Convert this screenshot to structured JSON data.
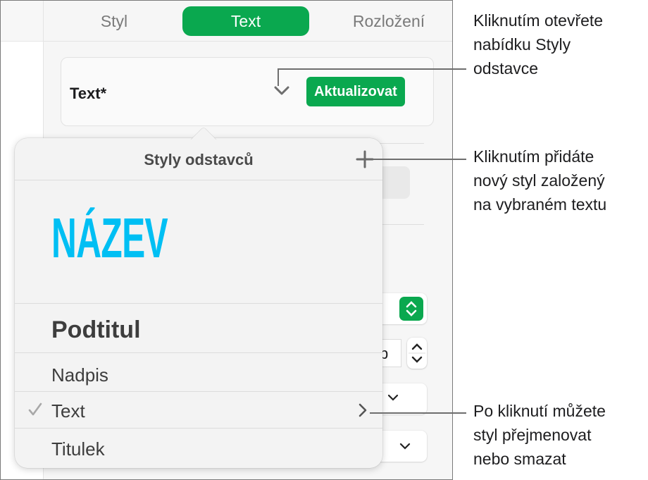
{
  "inspector": {
    "tabs": [
      {
        "label": "Styl",
        "active": false
      },
      {
        "label": "Text",
        "active": true
      },
      {
        "label": "Rozložení",
        "active": false
      }
    ],
    "paragraph_style": {
      "current": "Text*",
      "update_button": "Aktualizovat"
    },
    "partial_controls": {
      "number_field_fragment": "b"
    }
  },
  "popover": {
    "title": "Styly odstavců",
    "add_icon": "plus-icon",
    "styles": [
      {
        "label": "NÁZEV",
        "selected": false,
        "color": "#00bff3"
      },
      {
        "label": "Podtitul",
        "selected": false
      },
      {
        "label": "Nadpis",
        "selected": false
      },
      {
        "label": "Text",
        "selected": true
      },
      {
        "label": "Titulek",
        "selected": false
      }
    ]
  },
  "callouts": [
    {
      "text": "Kliknutím otevřete\nnabídku Styly\nodstavce"
    },
    {
      "text": "Kliknutím přidáte\nnový styl založený\nna vybraném textu"
    },
    {
      "text": "Po kliknutí můžete\nstyl přejmenovat\nnebo smazat"
    }
  ],
  "colors": {
    "accent_green": "#0aa84f",
    "title_blue": "#00bff3"
  }
}
